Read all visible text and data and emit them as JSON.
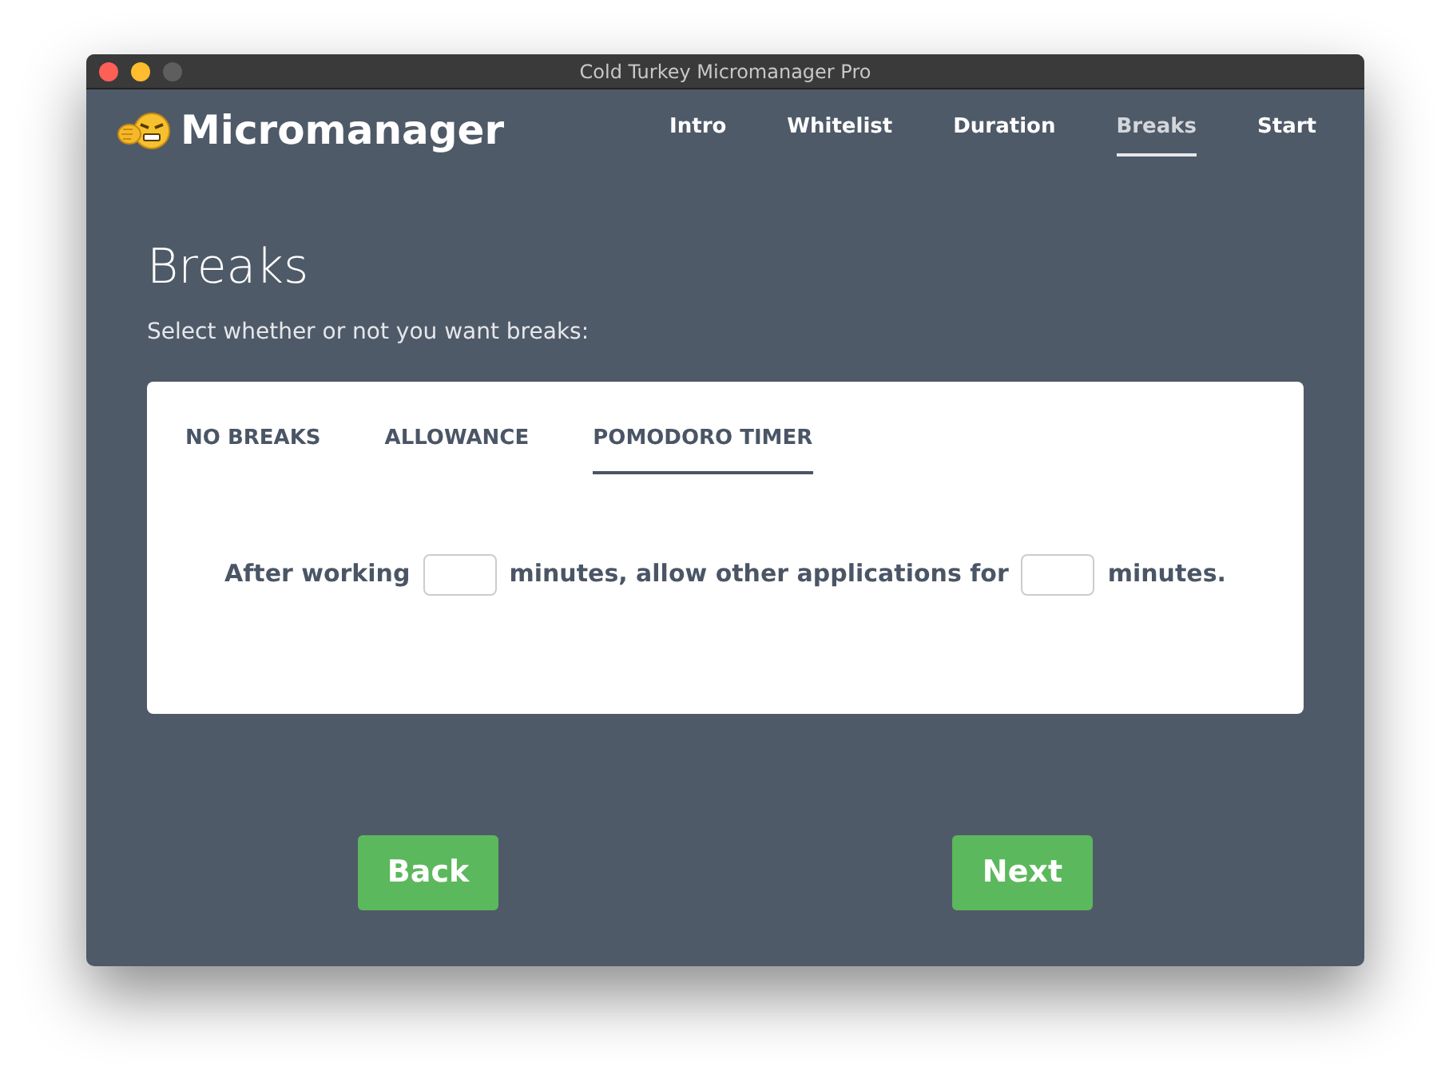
{
  "window": {
    "title": "Cold Turkey Micromanager Pro"
  },
  "app": {
    "name": "Micromanager"
  },
  "nav": [
    {
      "label": "Intro",
      "selected": false
    },
    {
      "label": "Whitelist",
      "selected": false
    },
    {
      "label": "Duration",
      "selected": false
    },
    {
      "label": "Breaks",
      "selected": true
    },
    {
      "label": "Start",
      "selected": false
    }
  ],
  "page": {
    "title": "Breaks",
    "subtitle": "Select whether or not you want breaks:"
  },
  "tabs": [
    {
      "label": "NO BREAKS",
      "selected": false
    },
    {
      "label": "ALLOWANCE",
      "selected": false
    },
    {
      "label": "POMODORO TIMER",
      "selected": true
    }
  ],
  "sentence": {
    "before": "After working",
    "middle": "minutes, allow other applications for",
    "after": "minutes."
  },
  "buttons": [
    {
      "label": "Back"
    },
    {
      "label": "Next"
    }
  ]
}
